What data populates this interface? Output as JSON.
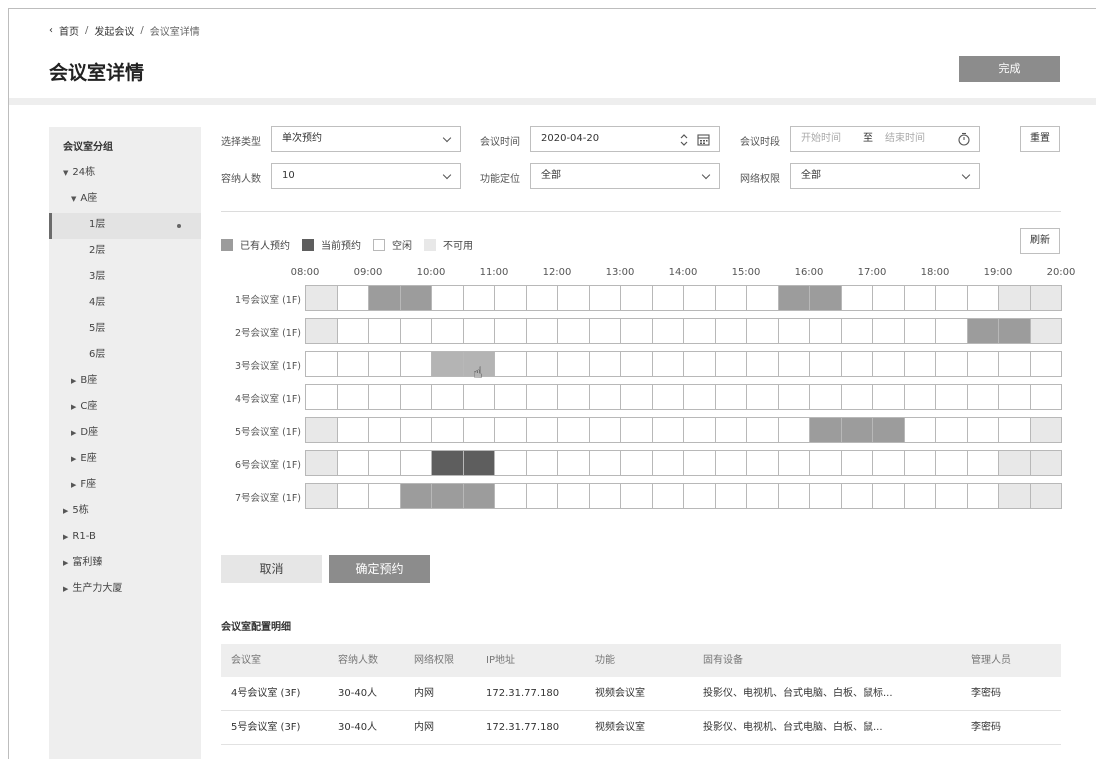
{
  "breadcrumb": {
    "home": "首页",
    "parent": "发起会议",
    "current": "会议室详情",
    "sep": "/"
  },
  "page_title": "会议室详情",
  "done_label": "完成",
  "sidebar": {
    "title": "会议室分组",
    "items": [
      {
        "label": "24栋",
        "arrow": "▼"
      },
      {
        "label": "A座",
        "arrow": "▼"
      },
      {
        "label": "1层",
        "arrow": ""
      },
      {
        "label": "2层",
        "arrow": ""
      },
      {
        "label": "3层",
        "arrow": ""
      },
      {
        "label": "4层",
        "arrow": ""
      },
      {
        "label": "5层",
        "arrow": ""
      },
      {
        "label": "6层",
        "arrow": ""
      },
      {
        "label": "B座",
        "arrow": "▶"
      },
      {
        "label": "C座",
        "arrow": "▶"
      },
      {
        "label": "D座",
        "arrow": "▶"
      },
      {
        "label": "E座",
        "arrow": "▶"
      },
      {
        "label": "F座",
        "arrow": "▶"
      },
      {
        "label": "5栋",
        "arrow": "▶"
      },
      {
        "label": "R1-B",
        "arrow": "▶"
      },
      {
        "label": "富利臻",
        "arrow": "▶"
      },
      {
        "label": "生产力大厦",
        "arrow": "▶"
      }
    ]
  },
  "filters": {
    "type_label": "选择类型",
    "type_value": "单次预约",
    "time_label": "会议时间",
    "time_value": "2020-04-20",
    "period_label": "会议时段",
    "period_start_ph": "开始时间",
    "period_to": "至",
    "period_end_ph": "结束时间",
    "reset_label": "重置",
    "capacity_label": "容纳人数",
    "capacity_value": "10",
    "function_label": "功能定位",
    "function_value": "全部",
    "network_label": "网络权限",
    "network_value": "全部"
  },
  "legend": [
    {
      "label": "已有人预约",
      "color": "#9c9c9c"
    },
    {
      "label": "当前预约",
      "color": "#5e5e5e"
    },
    {
      "label": "空闲",
      "color": "#ffffff"
    },
    {
      "label": "不可用",
      "color": "#e8e8e8"
    }
  ],
  "refresh_label": "刷新",
  "schedule": {
    "times": [
      "08:00",
      "09:00",
      "10:00",
      "11:00",
      "12:00",
      "13:00",
      "14:00",
      "15:00",
      "16:00",
      "17:00",
      "18:00",
      "19:00",
      "20:00"
    ],
    "colors": {
      "U": "#e8e8e8",
      "B": "#9c9c9c",
      "C": "#5e5e5e",
      "S": "#b4b4b4",
      "F": "#ffffff"
    },
    "rooms": [
      {
        "name": "1号会议室 (1F)",
        "slots": "UFBBFFFFFFFFFFFBBFFFFFUU"
      },
      {
        "name": "2号会议室 (1F)",
        "slots": "UFFFFFFFFFFFFFFFFFFFFBBU"
      },
      {
        "name": "3号会议室 (1F)",
        "slots": "FFFFSSFFFFFFFFFFFFFFFFFF"
      },
      {
        "name": "4号会议室 (1F)",
        "slots": "FFFFFFFFFFFFFFFFFFFFFFFF"
      },
      {
        "name": "5号会议室 (1F)",
        "slots": "UFFFFFFFFFFFFFFFBBBFFFFU"
      },
      {
        "name": "6号会议室 (1F)",
        "slots": "UFFFCCFFFFFFFFFFFFFFFFUU"
      },
      {
        "name": "7号会议室 (1F)",
        "slots": "UFFBBBFFFFFFFFFFFFFFFFUU"
      }
    ]
  },
  "actions": {
    "cancel_label": "取消",
    "confirm_label": "确定预约"
  },
  "details": {
    "title": "会议室配置明细",
    "headers": [
      "会议室",
      "容纳人数",
      "网络权限",
      "IP地址",
      "功能",
      "固有设备",
      "管理人员"
    ],
    "rows": [
      [
        "4号会议室 (3F)",
        "30-40人",
        "内网",
        "172.31.77.180",
        "视频会议室",
        "投影仪、电视机、台式电脑、白板、鼠标...",
        "李密码"
      ],
      [
        "5号会议室 (3F)",
        "30-40人",
        "内网",
        "172.31.77.180",
        "视频会议室",
        "投影仪、电视机、台式电脑、白板、鼠...",
        "李密码"
      ]
    ]
  }
}
